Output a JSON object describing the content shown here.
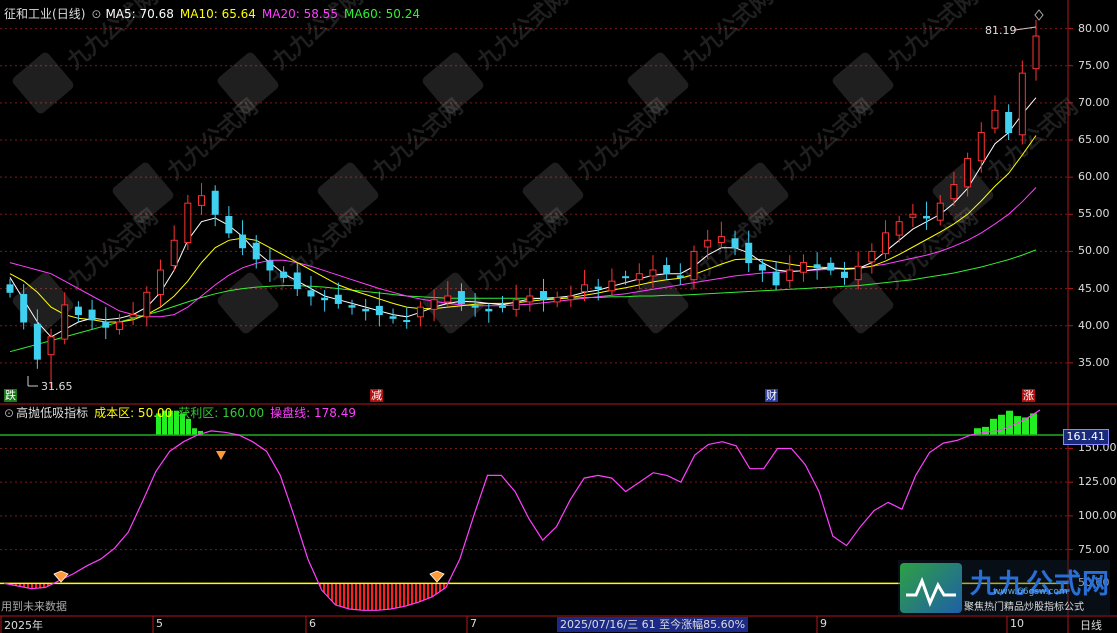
{
  "header": {
    "stock_name": "征和工业",
    "period": "(日线)",
    "ma_items": [
      {
        "label": "MA5: 70.68",
        "color": "#ffffff"
      },
      {
        "label": "MA10: 65.64",
        "color": "#ffff00"
      },
      {
        "label": "MA20: 58.55",
        "color": "#ff40ff"
      },
      {
        "label": "MA60: 50.24",
        "color": "#33ee33"
      }
    ]
  },
  "indicator_header": {
    "name": "高抛低吸指标",
    "items": [
      {
        "label": "成本区: 50.00",
        "color": "#ffff00"
      },
      {
        "label": "获利区: 160.00",
        "color": "#33cc33"
      },
      {
        "label": "操盘线: 178.49",
        "color": "#ff40ff"
      }
    ]
  },
  "price_axis": {
    "ticks": [
      "80.00",
      "75.00",
      "70.00",
      "65.00",
      "60.00",
      "55.00",
      "50.00",
      "45.00",
      "40.00",
      "35.00"
    ],
    "min": 30.0,
    "max": 82.5
  },
  "indicator_axis": {
    "ticks": [
      "150.00",
      "125.00",
      "100.00",
      "75.00",
      "50.00"
    ],
    "min": 28,
    "max": 180,
    "current_tag": "161.41"
  },
  "annotations": {
    "high_label": "81.19",
    "low_label": "31.65",
    "event_markers": [
      {
        "text": "跌",
        "bg": "#1a7a1a"
      },
      {
        "text": "减",
        "bg": "#b01010"
      },
      {
        "text": "财",
        "bg": "#2a3aa0"
      },
      {
        "text": "涨",
        "bg": "#b01010"
      }
    ],
    "future_data_note": "用到未来数据"
  },
  "time_axis": {
    "labels": [
      "2025年",
      "5",
      "6",
      "7",
      "9",
      "10",
      "日线"
    ],
    "status_text": "2025/07/16/三 61 至今涨幅85.60%"
  },
  "watermark": {
    "brand": "九九公式网",
    "slogan": "聚焦热门精品炒股指标公式",
    "url": "www.66gsw.com"
  },
  "chart_data": [
    {
      "type": "candlestick",
      "title": "征和工业 (日线)",
      "series_names": [
        "MA5",
        "MA10",
        "MA20",
        "MA60"
      ],
      "ylim": [
        30,
        82.5
      ],
      "high": 81.19,
      "low": 31.65,
      "close_trend": [
        44.5,
        40.5,
        35.5,
        38.5,
        42.8,
        41.5,
        40.8,
        39.8,
        40.5,
        41.5,
        44.5,
        47.5,
        51.5,
        56.5,
        57.5,
        55.0,
        52.5,
        50.5,
        49.0,
        47.5,
        46.5,
        45.0,
        44.0,
        43.5,
        43.0,
        42.5,
        42.0,
        41.5,
        41.0,
        40.6,
        42.5,
        43.5,
        44.0,
        43.0,
        42.5,
        42.0,
        42.5,
        43.5,
        44.0,
        43.5,
        43.8,
        44.0,
        45.5,
        45.0,
        46.0,
        46.5,
        47.0,
        47.5,
        47.0,
        46.5,
        50.0,
        51.5,
        52.0,
        50.5,
        48.5,
        47.5,
        45.5,
        47.5,
        48.5,
        47.8,
        47.5,
        46.5,
        48.0,
        50.0,
        52.5,
        54.0,
        55.0,
        54.5,
        56.5,
        59.0,
        62.5,
        66.0,
        69.0,
        66.0,
        74.0,
        79.0
      ],
      "ma5_trend": [
        46.5,
        43.5,
        40.5,
        38.5,
        39.5,
        40.5,
        41.0,
        40.8,
        41.0,
        41.5,
        42.5,
        44.5,
        47.5,
        51.5,
        54.0,
        54.5,
        53.5,
        52.0,
        50.0,
        48.5,
        47.0,
        46.0,
        45.0,
        44.0,
        43.5,
        43.0,
        42.5,
        42.0,
        41.5,
        41.2,
        41.8,
        42.5,
        43.0,
        43.3,
        43.2,
        43.0,
        42.8,
        43.2,
        43.6,
        43.7,
        43.8,
        44.0,
        44.5,
        44.8,
        45.3,
        45.8,
        46.3,
        46.8,
        47.0,
        47.0,
        48.0,
        49.5,
        50.5,
        50.5,
        49.8,
        48.5,
        47.5,
        47.3,
        47.4,
        47.6,
        47.8,
        47.6,
        47.7,
        48.5,
        50.0,
        51.5,
        53.0,
        54.0,
        55.0,
        56.5,
        58.5,
        61.5,
        64.5,
        66.0,
        68.5,
        70.7
      ],
      "ma10_trend": [
        47.0,
        46.0,
        44.5,
        42.5,
        41.5,
        41.0,
        40.8,
        40.5,
        40.5,
        40.8,
        41.5,
        42.5,
        44.0,
        46.0,
        48.5,
        50.5,
        51.5,
        51.8,
        51.5,
        50.5,
        49.5,
        48.5,
        47.5,
        46.5,
        45.5,
        44.8,
        44.2,
        43.6,
        43.0,
        42.5,
        42.3,
        42.3,
        42.5,
        42.7,
        42.9,
        43.0,
        43.0,
        43.1,
        43.3,
        43.5,
        43.6,
        43.8,
        44.1,
        44.4,
        44.8,
        45.1,
        45.5,
        45.9,
        46.2,
        46.4,
        46.9,
        47.6,
        48.3,
        48.9,
        49.0,
        48.9,
        48.6,
        48.3,
        48.0,
        47.9,
        47.8,
        47.7,
        47.7,
        48.0,
        48.7,
        49.6,
        50.6,
        51.6,
        52.6,
        53.7,
        55.0,
        56.8,
        58.8,
        60.5,
        63.0,
        65.6
      ],
      "ma20_trend": [
        48.5,
        48.0,
        47.5,
        47.0,
        46.0,
        45.0,
        44.0,
        43.0,
        42.0,
        41.5,
        41.2,
        41.2,
        41.5,
        42.5,
        44.0,
        45.5,
        46.8,
        47.8,
        48.4,
        48.8,
        48.8,
        48.5,
        48.0,
        47.4,
        46.8,
        46.2,
        45.6,
        45.0,
        44.5,
        44.0,
        43.6,
        43.3,
        43.0,
        42.8,
        42.7,
        42.7,
        42.7,
        42.8,
        42.9,
        43.1,
        43.3,
        43.5,
        43.7,
        43.9,
        44.1,
        44.3,
        44.6,
        44.9,
        45.2,
        45.5,
        45.8,
        46.1,
        46.4,
        46.7,
        46.9,
        47.1,
        47.2,
        47.3,
        47.4,
        47.5,
        47.6,
        47.7,
        47.8,
        48.0,
        48.3,
        48.7,
        49.1,
        49.5,
        50.0,
        50.7,
        51.5,
        52.5,
        53.7,
        55.0,
        56.7,
        58.6
      ],
      "ma60_trend": [
        36.5,
        37.0,
        37.5,
        38.0,
        38.5,
        39.0,
        39.5,
        40.0,
        40.5,
        41.0,
        41.5,
        42.0,
        42.6,
        43.2,
        43.8,
        44.3,
        44.7,
        45.0,
        45.2,
        45.3,
        45.4,
        45.4,
        45.3,
        45.2,
        45.0,
        44.8,
        44.6,
        44.4,
        44.2,
        44.0,
        43.9,
        43.8,
        43.7,
        43.7,
        43.7,
        43.7,
        43.7,
        43.7,
        43.7,
        43.7,
        43.7,
        43.7,
        43.8,
        43.8,
        43.9,
        43.9,
        44.0,
        44.0,
        44.1,
        44.1,
        44.2,
        44.3,
        44.4,
        44.5,
        44.6,
        44.7,
        44.8,
        44.9,
        45.0,
        45.1,
        45.2,
        45.3,
        45.4,
        45.6,
        45.8,
        46.0,
        46.2,
        46.5,
        46.8,
        47.1,
        47.5,
        47.9,
        48.4,
        48.9,
        49.5,
        50.2
      ]
    },
    {
      "type": "line",
      "title": "高抛低吸指标",
      "series_names": [
        "成本区",
        "获利区",
        "操盘线"
      ],
      "cost_zone": 50,
      "profit_zone": 160,
      "ylim": [
        28,
        180
      ],
      "line_trend": [
        50,
        48,
        46,
        47,
        52,
        57,
        63,
        68,
        76,
        88,
        110,
        133,
        148,
        155,
        160,
        163,
        162,
        160,
        155,
        148,
        130,
        100,
        68,
        45,
        34,
        31,
        30,
        30,
        31,
        33,
        36,
        40,
        47,
        68,
        100,
        130,
        130,
        118,
        98,
        82,
        92,
        112,
        128,
        130,
        128,
        118,
        125,
        132,
        130,
        125,
        145,
        153,
        155,
        152,
        135,
        135,
        150,
        150,
        138,
        118,
        85,
        78,
        92,
        104,
        110,
        105,
        130,
        147,
        154,
        156,
        160,
        162,
        163,
        167,
        172,
        178.5
      ],
      "bar_top_values": [
        176,
        178,
        178,
        178,
        176,
        172,
        165,
        163,
        165,
        166,
        172,
        175,
        178,
        174,
        173,
        176
      ]
    }
  ]
}
